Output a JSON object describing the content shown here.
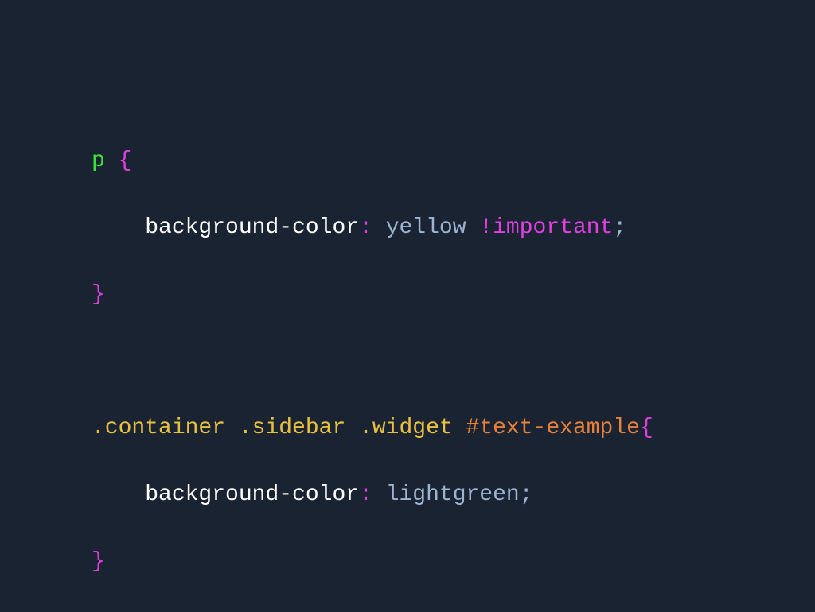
{
  "code": {
    "rule1": {
      "selector": "p",
      "indent": "    ",
      "property": "background-color",
      "value": "yellow",
      "important": "!important"
    },
    "rule2": {
      "class1": ".container",
      "class2": ".sidebar",
      "class3": ".widget",
      "id": "#text-example",
      "indent": "    ",
      "property": "background-color",
      "value": "lightgreen"
    },
    "braceOpen": "{",
    "braceClose": "}",
    "colon": ":",
    "semicolon": ";",
    "space": " "
  }
}
